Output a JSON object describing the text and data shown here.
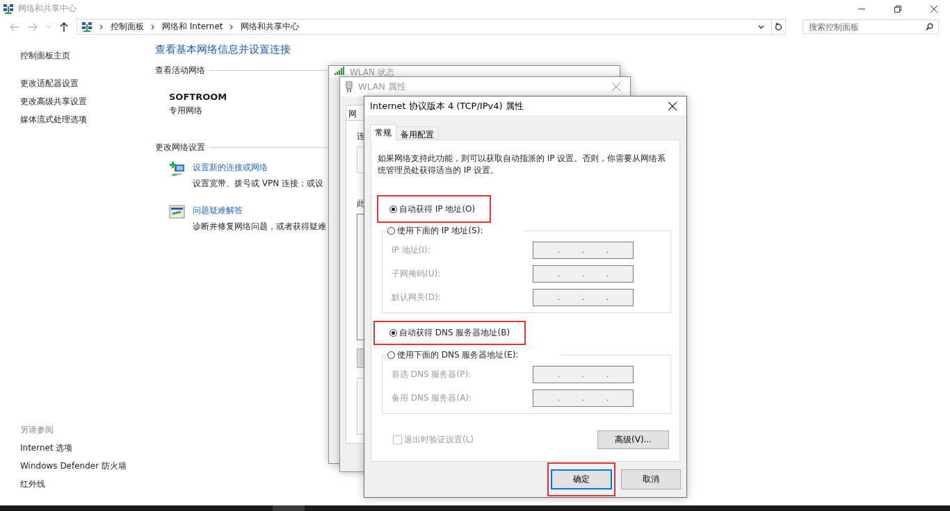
{
  "window": {
    "title": "网络和共享中心"
  },
  "address_bar": {
    "breadcrumbs": [
      "控制面板",
      "网络和 Internet",
      "网络和共享中心"
    ]
  },
  "search": {
    "placeholder": "搜索控制面板"
  },
  "sidebar": {
    "items": [
      "控制面板主页",
      "更改适配器设置",
      "更改高级共享设置",
      "媒体流式处理选项"
    ],
    "see_also_heading": "另请参阅",
    "see_also": [
      "Internet 选项",
      "Windows Defender 防火墙",
      "红外线"
    ]
  },
  "content": {
    "heading": "查看基本网络信息并设置连接",
    "active_heading": "查看活动网络",
    "network_name": "SOFTROOM",
    "network_type": "专用网络",
    "change_heading": "更改网络设置",
    "tasks": [
      {
        "kind": "new_connection",
        "link": "设置新的连接或网络",
        "description": "设置宽带、拨号或 VPN 连接；或设"
      },
      {
        "kind": "troubleshoot",
        "link": "问题疑难解答",
        "description": "诊断并修复网络问题，或者获得疑难"
      }
    ]
  },
  "status_window": {
    "title": "WLAN 状态"
  },
  "properties_window": {
    "title": "WLAN 属性",
    "tab": "网",
    "label_1": "连",
    "label_2": "此"
  },
  "ipv4_dialog": {
    "title": "Internet 协议版本 4 (TCP/IPv4) 属性",
    "tabs": [
      {
        "label": "常规",
        "selected": true
      },
      {
        "label": "备用配置",
        "selected": false
      }
    ],
    "description": "如果网络支持此功能，则可以获取自动指派的 IP 设置。否则，你需要从网络系统管理员处获得适当的 IP 设置。",
    "ip_auto": {
      "label": "自动获得 IP 地址(O)",
      "selected": true,
      "highlighted": true
    },
    "ip_manual": {
      "label": "使用下面的 IP 地址(S):",
      "selected": false
    },
    "ip_fields": [
      {
        "label": "IP 地址(I):",
        "value": ". . .",
        "disabled": true
      },
      {
        "label": "子网掩码(U):",
        "value": ". . .",
        "disabled": true
      },
      {
        "label": "默认网关(D):",
        "value": ". . .",
        "disabled": true
      }
    ],
    "dns_auto": {
      "label": "自动获得 DNS 服务器地址(B)",
      "selected": true,
      "highlighted": true
    },
    "dns_manual": {
      "label": "使用下面的 DNS 服务器地址(E):",
      "selected": false
    },
    "dns_fields": [
      {
        "label": "首选 DNS 服务器(P):",
        "value": ". . .",
        "disabled": true
      },
      {
        "label": "备用 DNS 服务器(A):",
        "value": ". . .",
        "disabled": true
      }
    ],
    "validate": {
      "label": "退出时验证设置(L)",
      "checked": false,
      "disabled": true
    },
    "advanced_button": "高级(V)...",
    "ok_button": {
      "label": "确定",
      "highlighted": true
    },
    "cancel_button": "取消"
  }
}
